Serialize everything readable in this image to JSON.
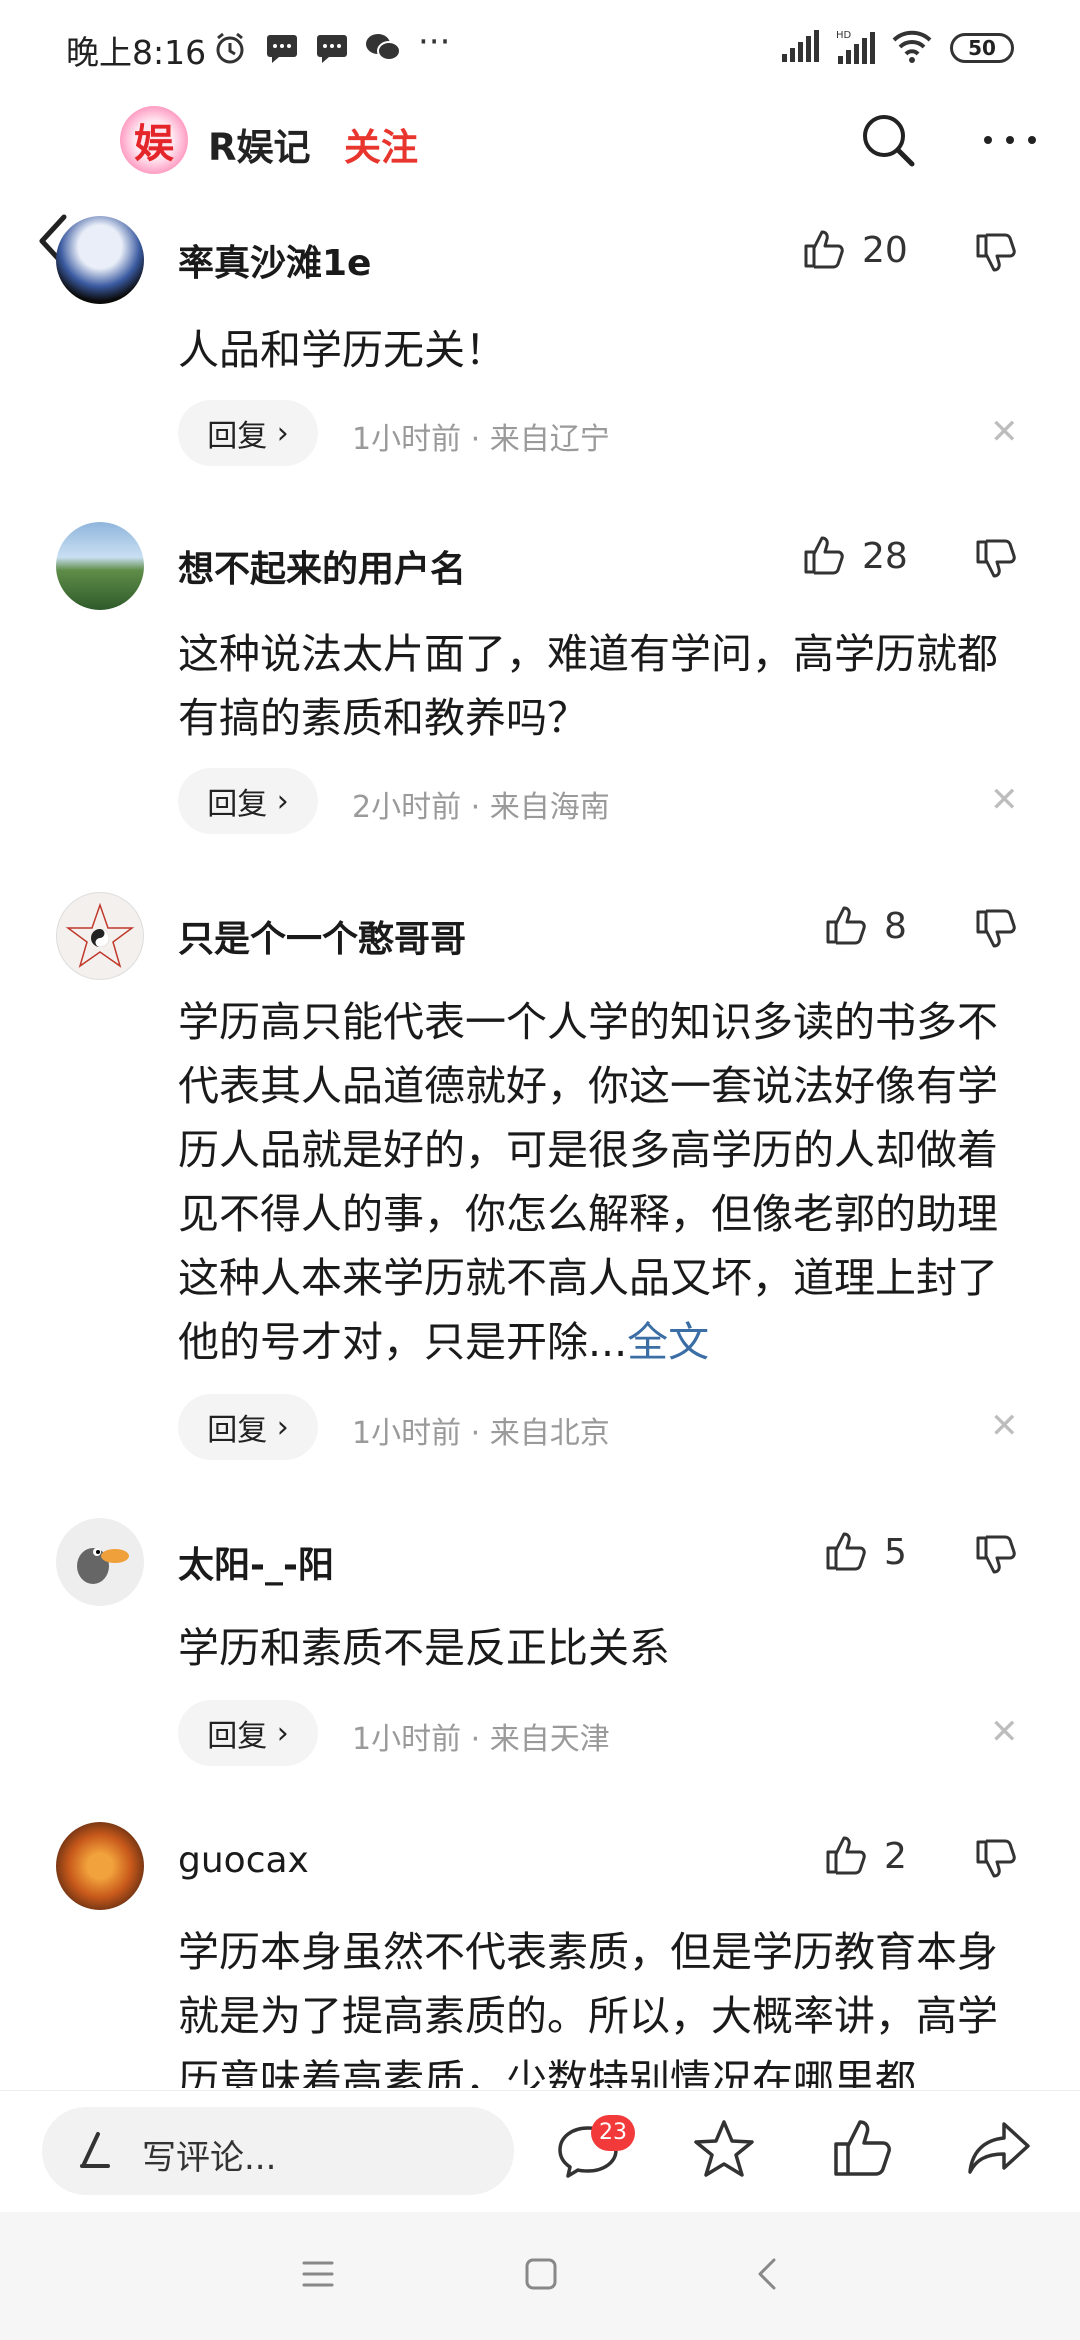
{
  "status_bar": {
    "time": "晚上8:16",
    "more_glyph": "···",
    "battery": "50"
  },
  "nav": {
    "back_icon": "back-arrow",
    "channel_logo": "娱",
    "channel_name": "R娱记",
    "follow_label": "关注"
  },
  "reply_label": "回复",
  "comments": [
    {
      "user": "率真沙滩1e",
      "likes": "20",
      "text": "人品和学历无关！",
      "more": "",
      "meta": "1小时前 · 来自辽宁"
    },
    {
      "user": "想不起来的用户名",
      "likes": "28",
      "text": "这种说法太片面了，难道有学问，高学历就都有搞的素质和教养吗？",
      "more": "",
      "meta": "2小时前 · 来自海南"
    },
    {
      "user": "只是个一个憨哥哥",
      "likes": "8",
      "text": "学历高只能代表一个人学的知识多读的书多不代表其人品道德就好，你这一套说法好像有学历人品就是好的，可是很多高学历的人却做着见不得人的事，你怎么解释，但像老郭的助理这种人本来学历就不高人品又坏，道理上封了他的号才对，只是开除...",
      "more": "全文",
      "meta": "1小时前 · 来自北京"
    },
    {
      "user": "太阳-_-阳",
      "likes": "5",
      "text": "学历和素质不是反正比关系",
      "more": "",
      "meta": "1小时前 · 来自天津"
    },
    {
      "user": "guocax",
      "likes": "2",
      "text": "学历本身虽然不代表素质，但是学历教育本身就是为了提高素质的。所以，大概率讲，高学历意味着高素质，少数特别情况在哪里都",
      "more": "",
      "meta": ""
    }
  ],
  "bottom_bar": {
    "write_placeholder": "写评论...",
    "comment_count": "23"
  },
  "colors": {
    "follow_red": "#e8362e",
    "link_blue": "#3a6ea5",
    "badge_red": "#f23a3a"
  }
}
